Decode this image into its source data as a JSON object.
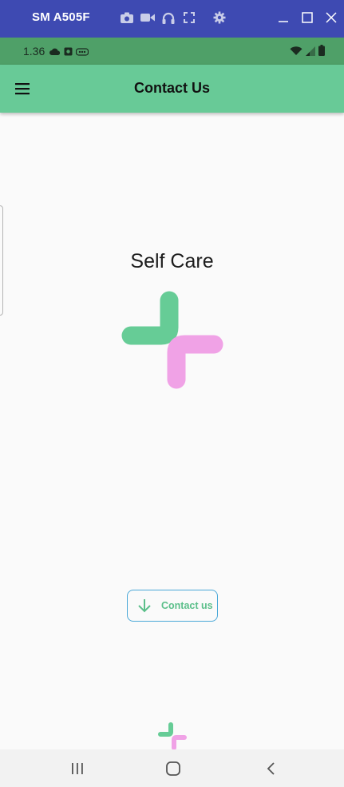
{
  "window": {
    "device_name": "SM A505F",
    "tool_icons": [
      "camera-icon",
      "video-icon",
      "headphones-icon",
      "fullscreen-icon",
      "gear-icon"
    ],
    "control_icons": [
      "minimize-icon",
      "maximize-icon",
      "close-icon"
    ]
  },
  "status_bar": {
    "time": "1.36",
    "left_icons": [
      "cloud-icon",
      "app-notification-icon",
      "sd-icon"
    ],
    "right_icons": [
      "wifi-icon",
      "signal-icon",
      "battery-icon"
    ]
  },
  "app_bar": {
    "title": "Contact Us",
    "menu_icon": "hamburger-menu-icon"
  },
  "main": {
    "brand_title": "Self Care",
    "logo_colors": {
      "green": "#66cc96",
      "pink": "#f0a2e6"
    },
    "contact_button": {
      "label": "Contact us",
      "icon": "arrow-down-icon"
    }
  },
  "colors": {
    "window_bar": "#3e4ab2",
    "status_bar": "#4fa068",
    "app_bar": "#68ca97",
    "button_border": "#4aa8d8",
    "button_text": "#5bbf8a"
  },
  "nav_bar": {
    "buttons": [
      "recent-apps-icon",
      "home-icon",
      "back-icon"
    ]
  }
}
